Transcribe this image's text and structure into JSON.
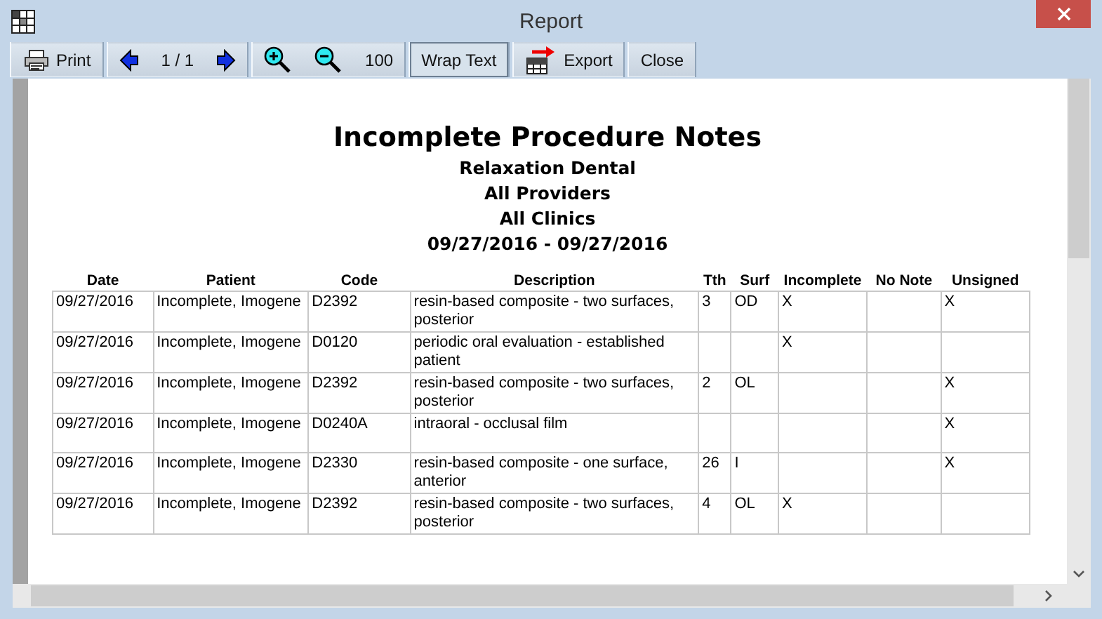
{
  "window": {
    "title": "Report"
  },
  "toolbar": {
    "groups": [
      [
        {
          "kind": "print",
          "label": "Print",
          "pressed": false
        }
      ],
      [
        {
          "kind": "prev",
          "pressed": false
        },
        {
          "kind": "text",
          "label": "1 / 1",
          "pressed": false
        },
        {
          "kind": "next",
          "pressed": false
        }
      ],
      [
        {
          "kind": "zoom-in",
          "pressed": false
        },
        {
          "kind": "zoom-out",
          "pressed": false
        },
        {
          "kind": "text",
          "label": "100",
          "pressed": false
        }
      ],
      [
        {
          "kind": "text",
          "label": "Wrap Text",
          "pressed": true
        }
      ],
      [
        {
          "kind": "export",
          "label": "Export",
          "pressed": false
        }
      ],
      [
        {
          "kind": "text",
          "label": "Close",
          "pressed": false
        }
      ]
    ]
  },
  "report": {
    "title": "Incomplete Procedure Notes",
    "subtitles": [
      "Relaxation Dental",
      "All Providers",
      "All Clinics",
      "09/27/2016 - 09/27/2016"
    ],
    "table": {
      "columns": [
        "Date",
        "Patient",
        "Code",
        "Description",
        "Tth",
        "Surf",
        "Incomplete",
        "No Note",
        "Unsigned"
      ],
      "rows": [
        [
          "09/27/2016",
          "Incomplete, Imogene",
          "D2392",
          "resin-based composite - two surfaces, posterior",
          "3",
          "OD",
          "X",
          "",
          "X"
        ],
        [
          "09/27/2016",
          "Incomplete, Imogene",
          "D0120",
          "periodic oral evaluation - established patient",
          "",
          "",
          "X",
          "",
          ""
        ],
        [
          "09/27/2016",
          "Incomplete, Imogene",
          "D2392",
          "resin-based composite - two surfaces, posterior",
          "2",
          "OL",
          "",
          "",
          "X"
        ],
        [
          "09/27/2016",
          "Incomplete, Imogene",
          "D0240A",
          "intraoral - occlusal film",
          "",
          "",
          "",
          "",
          "X"
        ],
        [
          "09/27/2016",
          "Incomplete, Imogene",
          "D2330",
          "resin-based composite - one surface, anterior",
          "26",
          "I",
          "",
          "",
          "X"
        ],
        [
          "09/27/2016",
          "Incomplete, Imogene",
          "D2392",
          "resin-based composite - two surfaces, posterior",
          "4",
          "OL",
          "X",
          "",
          ""
        ]
      ]
    }
  }
}
